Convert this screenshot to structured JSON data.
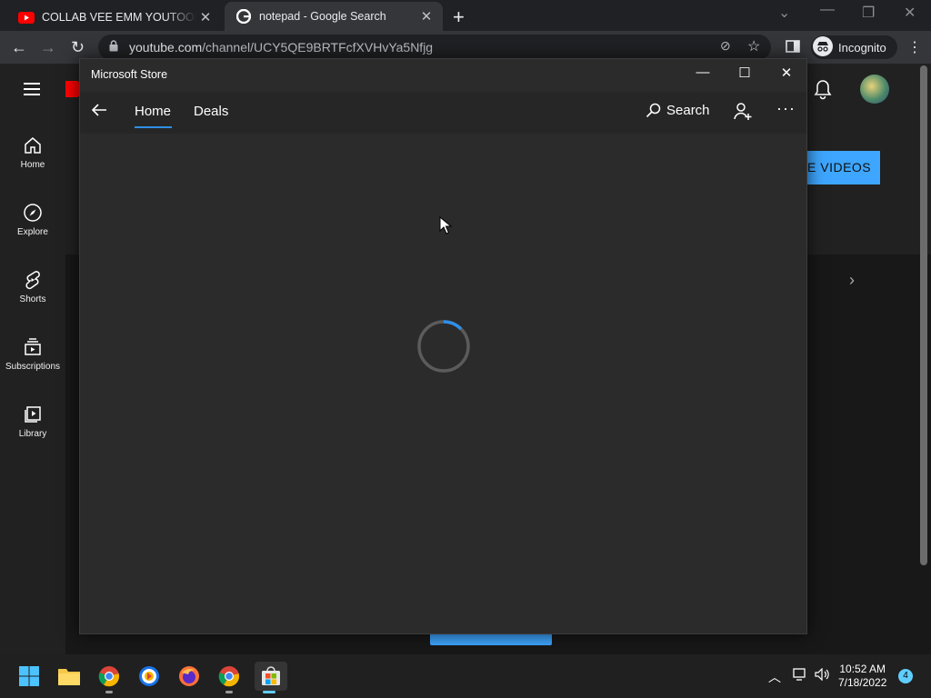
{
  "browser": {
    "tabs": [
      {
        "title": "COLLAB VEE EMM YOUTOOB - YouTube",
        "favicon": "youtube-icon",
        "active": false
      },
      {
        "title": "notepad - Google Search",
        "favicon": "google-icon",
        "active": true
      }
    ],
    "url_domain": "youtube.com",
    "url_path": "/channel/UCY5QE9BRTFcfXVHvYa5Nfjg",
    "incognito_label": "Incognito"
  },
  "youtube": {
    "sidebar": [
      {
        "label": "Home",
        "icon": "home-icon"
      },
      {
        "label": "Explore",
        "icon": "compass-icon"
      },
      {
        "label": "Shorts",
        "icon": "shorts-icon"
      },
      {
        "label": "Subscriptions",
        "icon": "subscriptions-icon"
      },
      {
        "label": "Library",
        "icon": "library-icon"
      }
    ],
    "subscribe_button_partial": "E VIDEOS"
  },
  "store": {
    "window_title": "Microsoft Store",
    "nav": {
      "home": "Home",
      "deals": "Deals",
      "search": "Search"
    },
    "loading": true,
    "accent": "#2f8fe8"
  },
  "taskbar": {
    "apps": [
      "start-icon",
      "file-explorer-icon",
      "chrome-icon",
      "brave-icon",
      "firefox-icon",
      "chrome-icon",
      "microsoft-store-icon"
    ],
    "time": "10:52 AM",
    "date": "7/18/2022",
    "notification_count": "4"
  }
}
